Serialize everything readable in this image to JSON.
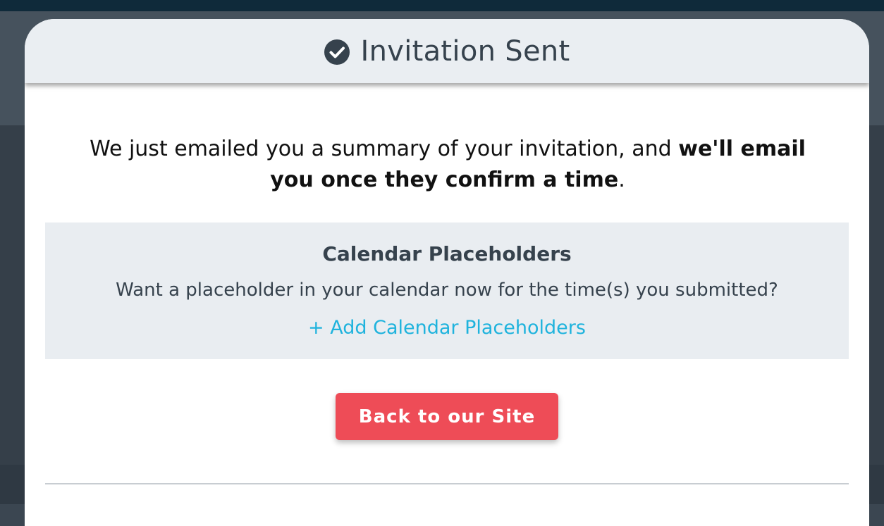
{
  "modal": {
    "title": "Invitation Sent",
    "message_part1": "We just emailed you a summary of your invitation, and ",
    "message_bold": "we'll email you once they confirm a time",
    "message_end": ".",
    "calendar_placeholders": {
      "heading": "Calendar Placeholders",
      "text": "Want a placeholder in your calendar now for the time(s) you submitted?",
      "link_label": "+ Add Calendar Placeholders"
    },
    "back_button_label": "Back to our Site"
  },
  "colors": {
    "accent_button": "#ee4c57",
    "link": "#1fb3dd",
    "header_bg": "#eaeef2",
    "title_text": "#36424d"
  },
  "icons": {
    "title_icon": "check-circle-icon"
  }
}
